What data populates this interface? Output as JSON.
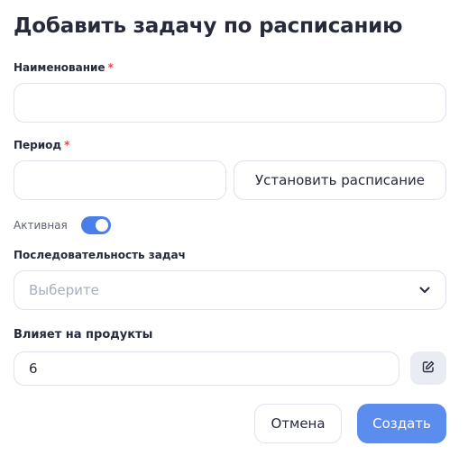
{
  "dialog": {
    "title": "Добавить задачу по расписанию"
  },
  "form": {
    "name": {
      "label": "Наименование",
      "required_mark": "*",
      "value": ""
    },
    "period": {
      "label": "Период",
      "required_mark": "*",
      "value": "",
      "schedule_button": "Установить расписание"
    },
    "active": {
      "label": "Активная",
      "checked": true
    },
    "sequence": {
      "label": "Последовательность задач",
      "placeholder": "Выберите"
    },
    "affects": {
      "label": "Влияет на продукты",
      "value": "6"
    }
  },
  "footer": {
    "cancel_label": "Отмена",
    "create_label": "Создать"
  },
  "colors": {
    "accent": "#5b8def",
    "required": "#e5484d",
    "border": "#dfe3ec"
  }
}
